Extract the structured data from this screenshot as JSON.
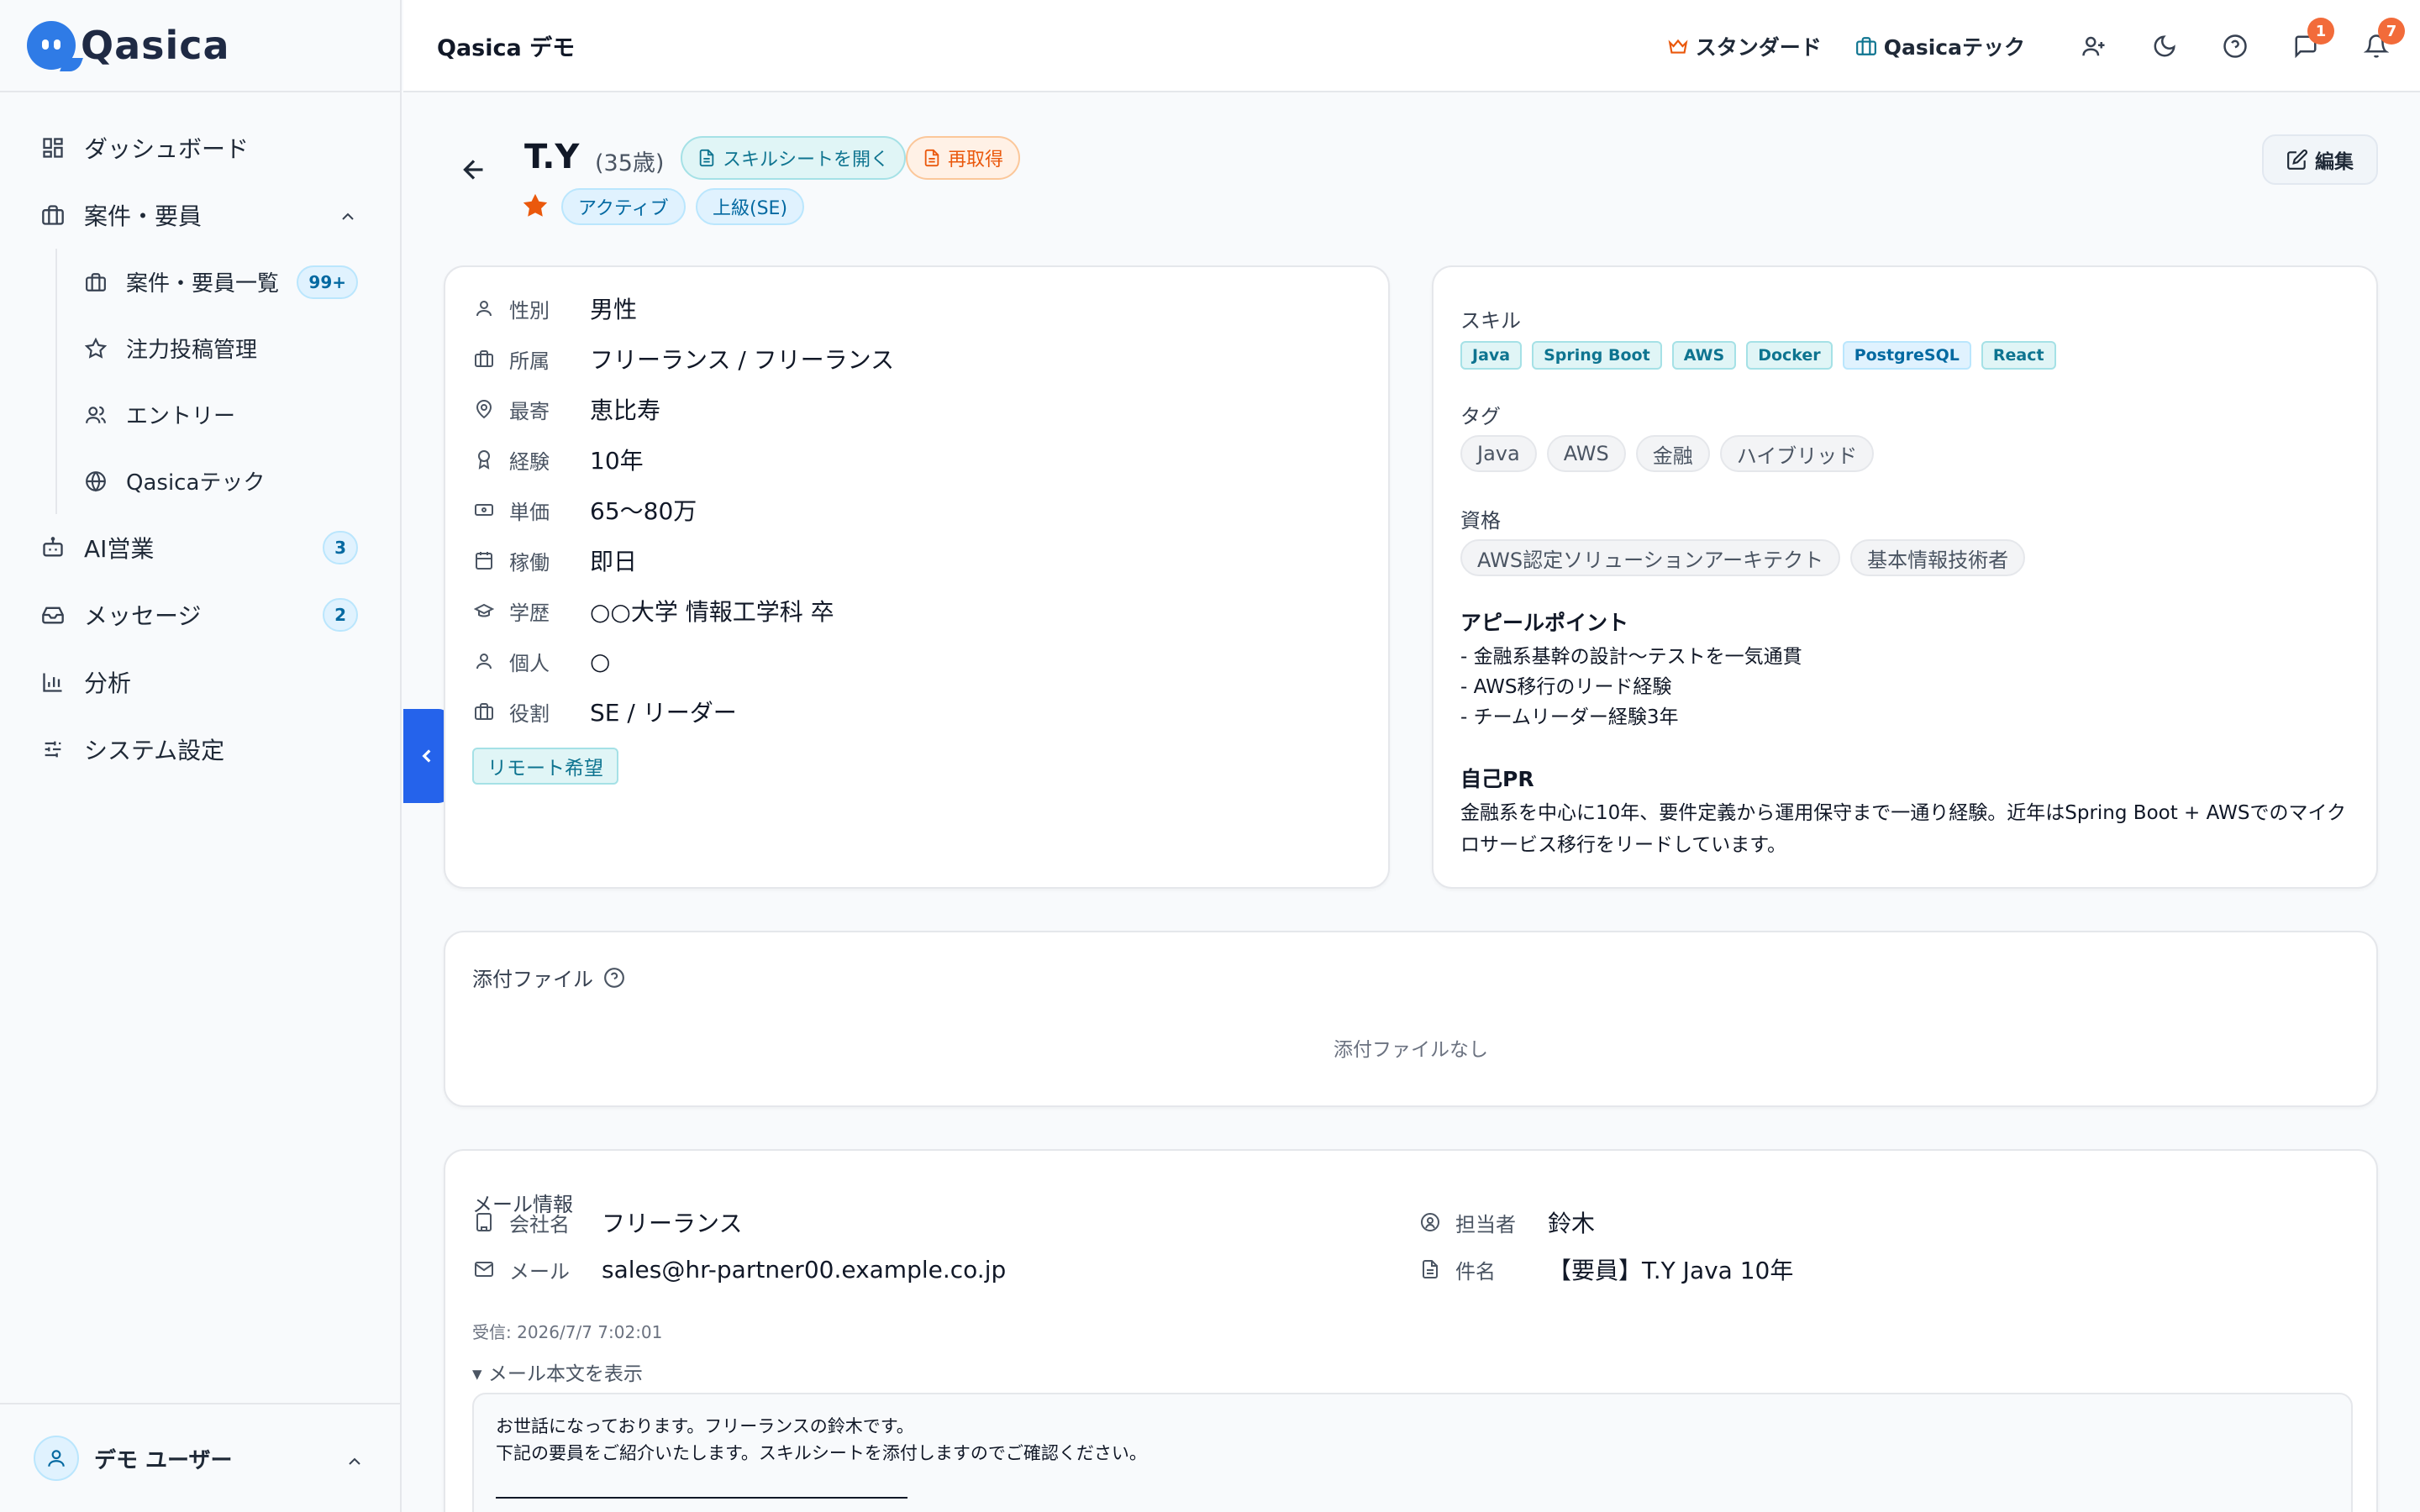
{
  "app": {
    "logo": "Qasica"
  },
  "sidebar": {
    "items": [
      {
        "label": "ダッシュボード",
        "icon": "dashboard-icon"
      },
      {
        "label": "案件・要員",
        "icon": "briefcase-icon"
      },
      {
        "label": "AI営業",
        "icon": "bot-icon",
        "badge": "3"
      },
      {
        "label": "メッセージ",
        "icon": "inbox-icon",
        "badge": "2"
      },
      {
        "label": "分析",
        "icon": "chart-icon"
      },
      {
        "label": "システム設定",
        "icon": "sliders-icon"
      }
    ],
    "subitems": [
      {
        "label": "案件・要員一覧",
        "icon": "briefcase-icon",
        "badge": "99+"
      },
      {
        "label": "注力投稿管理",
        "icon": "star-icon"
      },
      {
        "label": "エントリー",
        "icon": "users-icon"
      },
      {
        "label": "Qasicaテック",
        "icon": "globe-icon"
      }
    ],
    "user": "デモ ユーザー"
  },
  "topbar": {
    "title": "Qasica デモ",
    "plan": "スタンダード",
    "company": "Qasicaテック",
    "messages_badge": "1",
    "notifications_badge": "7"
  },
  "candidate": {
    "name": "T.Y",
    "age": "(35歳)",
    "open_sheet": "スキルシートを開く",
    "refetch": "再取得",
    "status": "アクティブ",
    "level": "上級(SE)",
    "edit": "編集",
    "details": [
      {
        "label": "性別",
        "value": "男性",
        "icon": "user-icon"
      },
      {
        "label": "所属",
        "value": "フリーランス / フリーランス",
        "icon": "briefcase-icon"
      },
      {
        "label": "最寄",
        "value": "恵比寿",
        "icon": "map-pin-icon"
      },
      {
        "label": "経験",
        "value": "10年",
        "icon": "award-icon"
      },
      {
        "label": "単価",
        "value": "65〜80万",
        "icon": "banknote-icon"
      },
      {
        "label": "稼働",
        "value": "即日",
        "icon": "calendar-icon"
      },
      {
        "label": "学歴",
        "value": "○○大学 情報工学科 卒",
        "icon": "graduation-cap-icon"
      },
      {
        "label": "個人",
        "value": "○",
        "icon": "user-icon"
      },
      {
        "label": "役割",
        "value": "SE / リーダー",
        "icon": "briefcase-icon"
      }
    ],
    "remote": "リモート希望",
    "skills_label": "スキル",
    "skills": [
      "Java",
      "Spring Boot",
      "AWS",
      "Docker",
      "PostgreSQL",
      "React"
    ],
    "tags_label": "タグ",
    "tags": [
      "Java",
      "AWS",
      "金融",
      "ハイブリッド"
    ],
    "certs_label": "資格",
    "certs": [
      "AWS認定ソリューションアーキテクト",
      "基本情報技術者"
    ],
    "appeal_label": "アピールポイント",
    "appeal": [
      "- 金融系基幹の設計〜テストを一気通貫",
      "- AWS移行のリード経験",
      "- チームリーダー経験3年"
    ],
    "pr_label": "自己PR",
    "pr": [
      "金融系を中心に10年、要件定義から運用保守まで一通り経験。近年はSpring Boot + AWSでのマイク",
      "ロサービス移行をリードしています。"
    ]
  },
  "attachments": {
    "title": "添付ファイル",
    "empty": "添付ファイルなし"
  },
  "mail": {
    "title": "メール情報",
    "company_label": "会社名",
    "company": "フリーランス",
    "email_label": "メール",
    "email": "sales@hr-partner00.example.co.jp",
    "owner_label": "担当者",
    "owner": "鈴木",
    "subject_label": "件名",
    "subject": "【要員】T.Y Java 10年",
    "received": "受信: 2026/7/7 7:02:01",
    "toggle": "▾ メール本文を表示",
    "body": [
      "お世話になっております。フリーランスの鈴木です。",
      "下記の要員をご紹介いたします。スキルシートを添付しますのでご確認ください。"
    ]
  },
  "colors": {
    "accent": "#2563eb",
    "teal": "#0e7490",
    "orange": "#ea580c",
    "badge": "#f26b3a"
  }
}
